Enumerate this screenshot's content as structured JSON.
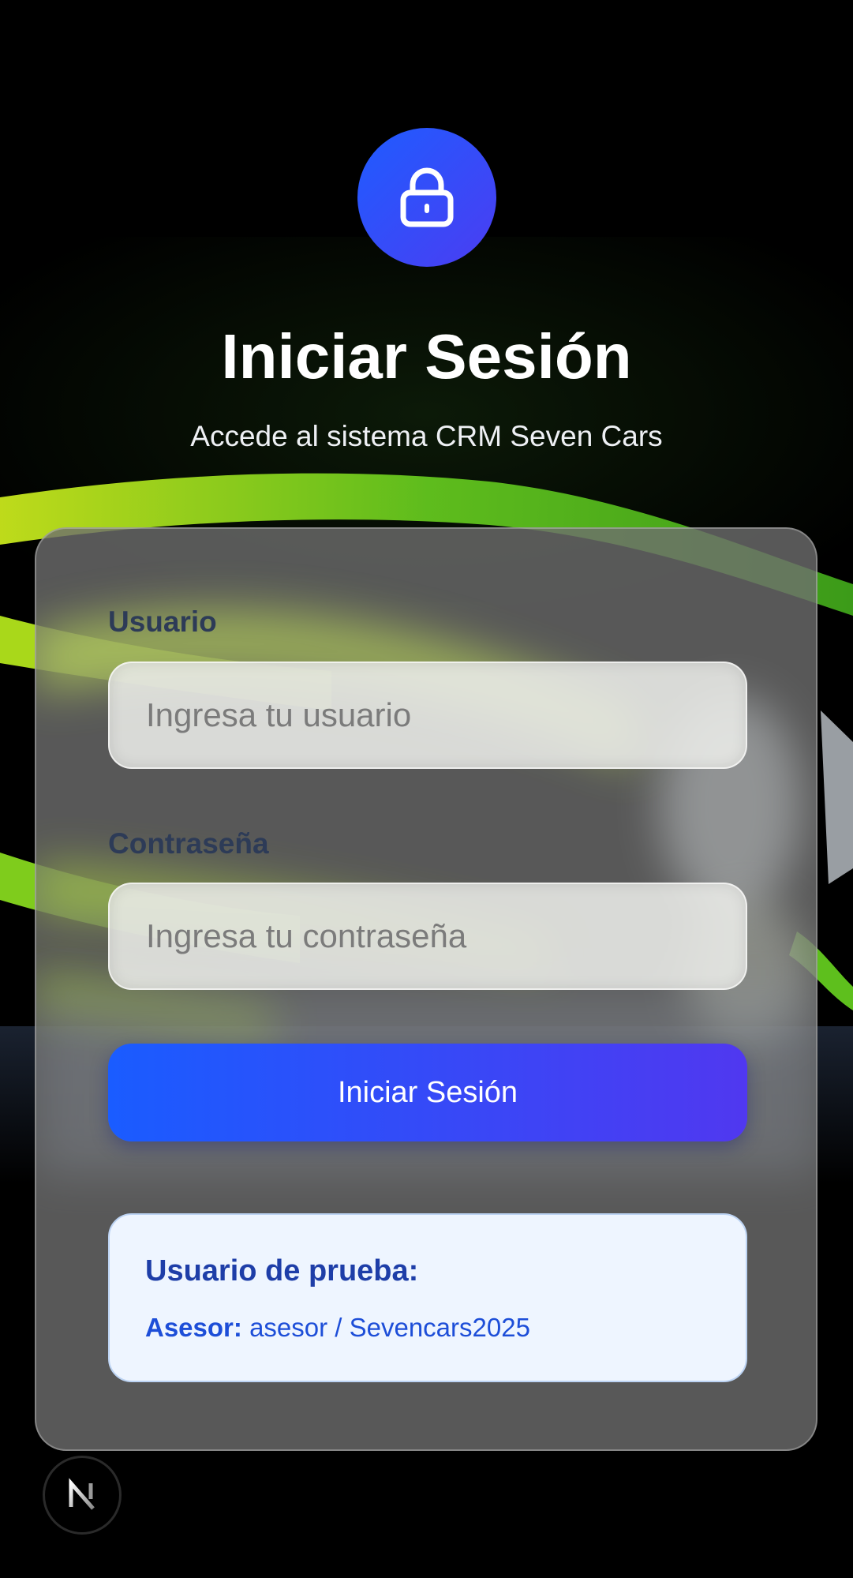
{
  "header": {
    "title": "Iniciar Sesión",
    "subtitle": "Accede al sistema CRM Seven Cars",
    "icon": "lock-icon"
  },
  "form": {
    "username_label": "Usuario",
    "username_placeholder": "Ingresa tu usuario",
    "username_value": "",
    "password_label": "Contraseña",
    "password_placeholder": "Ingresa tu contraseña",
    "password_value": "",
    "submit_label": "Iniciar Sesión"
  },
  "test_user": {
    "title": "Usuario de prueba:",
    "role_label": "Asesor:",
    "credentials": "asesor / Sevencars2025"
  },
  "badge": {
    "letter": "N",
    "icon": "nextjs-logo-icon"
  },
  "colors": {
    "accent_start": "#1f5cff",
    "accent_end": "#4b3df2",
    "info_bg": "#eef5ff",
    "info_text": "#1d4ed8",
    "car_green": "#7fd21b"
  }
}
